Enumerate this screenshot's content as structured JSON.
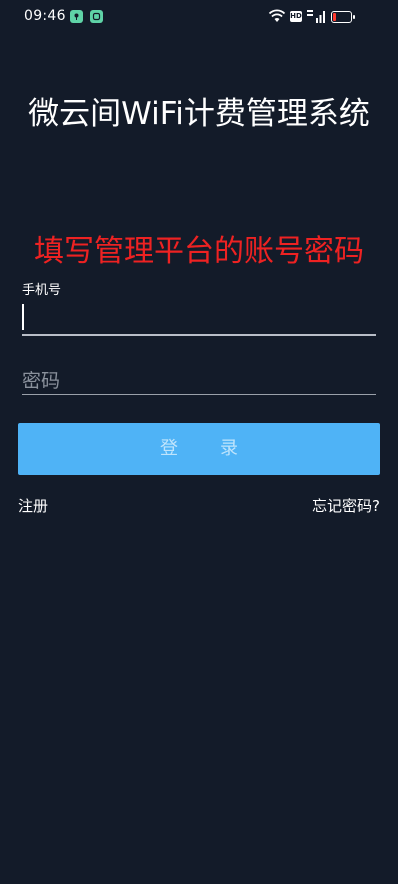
{
  "status_bar": {
    "time": "09:46",
    "hd_badge": "HD",
    "battery_level": 0.15,
    "icons": [
      "notification-icon",
      "notification-icon",
      "wifi-icon",
      "hd-icon",
      "signal-icon",
      "battery-icon"
    ]
  },
  "header": {
    "title": "微云间WiFi计费管理系统"
  },
  "hint": {
    "text": "填写管理平台的账号密码",
    "color": "#ee2222"
  },
  "form": {
    "phone_label": "手机号",
    "phone_value": "",
    "password_placeholder": "密码",
    "password_value": "",
    "login_label": "登录",
    "register_label": "注册",
    "forgot_label": "忘记密码?"
  },
  "colors": {
    "background": "#131b29",
    "button": "#4fb3f6",
    "accent_icon": "#5fd3a7"
  }
}
